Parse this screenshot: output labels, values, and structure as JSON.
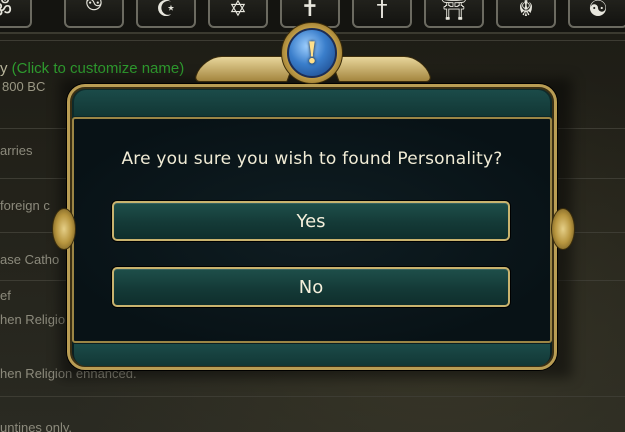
{
  "colors": {
    "gold_frame": "#b99d54",
    "teal_panel": "#143a37",
    "hint_green": "#2e9a2e",
    "text_light": "#f1ecd6"
  },
  "icon_strip": [
    {
      "glyph": "ॐ",
      "icon": "hinduism-icon"
    },
    {
      "glyph": "࿊",
      "icon": "buddhism-icon"
    },
    {
      "glyph": "☪",
      "icon": "islam-icon"
    },
    {
      "glyph": "✡",
      "icon": "judaism-icon"
    },
    {
      "glyph": "✝",
      "icon": "christianity-icon"
    },
    {
      "glyph": "†",
      "icon": "orthodoxy-icon"
    },
    {
      "glyph": "⛩",
      "icon": "shinto-icon"
    },
    {
      "glyph": "☬",
      "icon": "sikhism-icon"
    },
    {
      "glyph": "☯",
      "icon": "taoism-icon"
    }
  ],
  "background": {
    "title_prefix": "y",
    "title_hint": "(Click to customize name)",
    "date": "800 BC",
    "rows": [
      "arries",
      "foreign c",
      "ase Catho",
      "ef",
      "hen Religio",
      "hen Religion enhanced.",
      "untines only."
    ]
  },
  "dialog": {
    "question": "Are you sure you wish to found Personality?",
    "yes_label": "Yes",
    "no_label": "No"
  }
}
